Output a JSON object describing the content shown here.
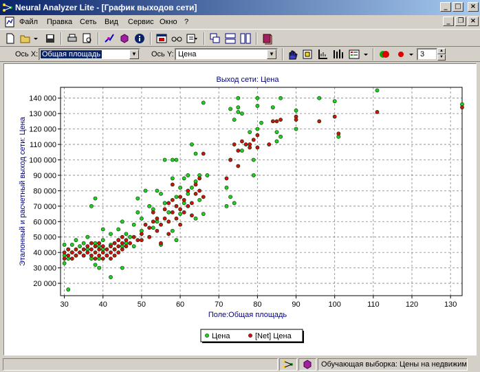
{
  "window": {
    "title": "Neural Analyzer Lite - [График выходов сети]",
    "minimize": "_",
    "maximize": "□",
    "close": "×",
    "restore": "❐"
  },
  "menu": {
    "items": [
      "Файл",
      "Правка",
      "Сеть",
      "Вид",
      "Сервис",
      "Окно",
      "?"
    ]
  },
  "toolbar": {
    "icons": [
      "new-file-icon",
      "open-folder-icon",
      "dropdown-arrow-icon",
      "save-icon",
      "print-icon",
      "print-preview-icon",
      "network-connect-icon",
      "cube-icon",
      "info-icon",
      "table-window-icon",
      "glasses-icon",
      "edit-dropdown-icon",
      "cascade-icon",
      "tile-horizontal-icon",
      "tile-vertical-icon",
      "book-icon"
    ]
  },
  "axis_bar": {
    "x_label": "Ось X:",
    "x_value": "Общая площадь",
    "y_label": "Ось Y:",
    "y_value": "Цена",
    "points_count": "3"
  },
  "colors": {
    "green": "#22cc22",
    "red": "#cc1111",
    "title_text": "#000080",
    "grid": "#808080"
  },
  "chart_data": {
    "type": "scatter",
    "title": "Выход сети: Цена",
    "xlabel": "Поле:Общая площадь",
    "ylabel": "Эталонный и расчетный выход сети: Цена",
    "xlim": [
      29,
      133
    ],
    "ylim": [
      12000,
      147000
    ],
    "x_ticks": [
      30,
      40,
      50,
      60,
      70,
      80,
      90,
      100,
      110,
      120,
      130
    ],
    "y_ticks": [
      20000,
      30000,
      40000,
      50000,
      60000,
      70000,
      80000,
      90000,
      100000,
      110000,
      120000,
      130000,
      140000
    ],
    "x_tick_labels": [
      "30",
      "40",
      "50",
      "60",
      "70",
      "80",
      "90",
      "100",
      "110",
      "120",
      "130"
    ],
    "y_tick_labels": [
      "20 000",
      "30 000",
      "40 000",
      "50 000",
      "60 000",
      "70 000",
      "80 000",
      "90 000",
      "100 000",
      "110 000",
      "120 000",
      "130 000",
      "140 000"
    ],
    "grid": true,
    "legend_position": "bottom",
    "series": [
      {
        "name": "Цена",
        "color": "#22cc22",
        "points": [
          [
            30,
            45
          ],
          [
            30,
            38
          ],
          [
            30,
            33
          ],
          [
            31,
            42
          ],
          [
            31,
            36
          ],
          [
            31,
            16
          ],
          [
            32,
            45
          ],
          [
            32,
            40
          ],
          [
            33,
            38
          ],
          [
            33,
            48
          ],
          [
            34,
            44
          ],
          [
            34,
            40
          ],
          [
            35,
            46
          ],
          [
            35,
            38
          ],
          [
            36,
            42
          ],
          [
            36,
            50
          ],
          [
            37,
            36
          ],
          [
            37,
            70
          ],
          [
            38,
            75
          ],
          [
            38,
            46
          ],
          [
            38,
            32
          ],
          [
            39,
            44
          ],
          [
            39,
            36
          ],
          [
            39,
            30
          ],
          [
            40,
            48
          ],
          [
            40,
            42
          ],
          [
            40,
            55
          ],
          [
            41,
            38
          ],
          [
            42,
            52
          ],
          [
            42,
            45
          ],
          [
            42,
            24
          ],
          [
            43,
            46
          ],
          [
            43,
            42
          ],
          [
            44,
            55
          ],
          [
            44,
            48
          ],
          [
            45,
            60
          ],
          [
            45,
            44
          ],
          [
            45,
            30
          ],
          [
            46,
            52
          ],
          [
            46,
            46
          ],
          [
            47,
            50
          ],
          [
            48,
            58
          ],
          [
            48,
            44
          ],
          [
            49,
            66
          ],
          [
            49,
            75
          ],
          [
            50,
            54
          ],
          [
            50,
            62
          ],
          [
            51,
            80
          ],
          [
            52,
            70
          ],
          [
            53,
            68
          ],
          [
            53,
            56
          ],
          [
            54,
            80
          ],
          [
            54,
            60
          ],
          [
            55,
            45
          ],
          [
            55,
            78
          ],
          [
            56,
            100
          ],
          [
            56,
            72
          ],
          [
            57,
            66
          ],
          [
            58,
            100
          ],
          [
            58,
            88
          ],
          [
            58,
            54
          ],
          [
            59,
            100
          ],
          [
            59,
            76
          ],
          [
            59,
            48
          ],
          [
            60,
            82
          ],
          [
            60,
            65
          ],
          [
            61,
            88
          ],
          [
            61,
            72
          ],
          [
            62,
            90
          ],
          [
            62,
            78
          ],
          [
            63,
            110
          ],
          [
            63,
            82
          ],
          [
            64,
            104
          ],
          [
            64,
            86
          ],
          [
            64,
            62
          ],
          [
            65,
            90
          ],
          [
            65,
            74
          ],
          [
            66,
            137
          ],
          [
            66,
            65
          ],
          [
            67,
            90
          ],
          [
            72,
            70
          ],
          [
            72,
            82
          ],
          [
            73,
            133
          ],
          [
            73,
            100
          ],
          [
            73,
            76
          ],
          [
            74,
            126
          ],
          [
            74,
            72
          ],
          [
            75,
            140
          ],
          [
            75,
            131
          ],
          [
            75,
            134
          ],
          [
            76,
            130
          ],
          [
            76,
            106
          ],
          [
            78,
            118
          ],
          [
            79,
            90
          ],
          [
            79,
            100
          ],
          [
            80,
            140
          ],
          [
            80,
            135
          ],
          [
            80,
            120
          ],
          [
            81,
            124
          ],
          [
            84,
            134
          ],
          [
            85,
            112
          ],
          [
            85,
            118
          ],
          [
            86,
            115
          ],
          [
            86,
            140
          ],
          [
            90,
            132
          ],
          [
            90,
            120
          ],
          [
            96,
            140
          ],
          [
            100,
            138
          ],
          [
            101,
            115
          ],
          [
            111,
            145
          ],
          [
            133,
            136
          ]
        ]
      },
      {
        "name": "[Net] Цена",
        "color": "#cc1111",
        "points": [
          [
            30,
            40
          ],
          [
            30,
            36
          ],
          [
            31,
            42
          ],
          [
            31,
            38
          ],
          [
            32,
            40
          ],
          [
            32,
            36
          ],
          [
            33,
            42
          ],
          [
            33,
            38
          ],
          [
            34,
            40
          ],
          [
            35,
            42
          ],
          [
            35,
            38
          ],
          [
            36,
            44
          ],
          [
            36,
            40
          ],
          [
            37,
            46
          ],
          [
            37,
            42
          ],
          [
            37,
            38
          ],
          [
            38,
            44
          ],
          [
            38,
            40
          ],
          [
            38,
            36
          ],
          [
            39,
            46
          ],
          [
            39,
            42
          ],
          [
            39,
            38
          ],
          [
            40,
            44
          ],
          [
            40,
            40
          ],
          [
            40,
            36
          ],
          [
            41,
            42
          ],
          [
            41,
            38
          ],
          [
            42,
            44
          ],
          [
            42,
            40
          ],
          [
            42,
            36
          ],
          [
            43,
            46
          ],
          [
            43,
            42
          ],
          [
            43,
            38
          ],
          [
            44,
            48
          ],
          [
            44,
            44
          ],
          [
            44,
            40
          ],
          [
            45,
            46
          ],
          [
            45,
            42
          ],
          [
            45,
            50
          ],
          [
            46,
            44
          ],
          [
            46,
            48
          ],
          [
            47,
            46
          ],
          [
            48,
            50
          ],
          [
            49,
            48
          ],
          [
            50,
            52
          ],
          [
            50,
            48
          ],
          [
            51,
            58
          ],
          [
            52,
            56
          ],
          [
            52,
            50
          ],
          [
            53,
            60
          ],
          [
            53,
            66
          ],
          [
            54,
            62
          ],
          [
            54,
            54
          ],
          [
            55,
            58
          ],
          [
            55,
            46
          ],
          [
            56,
            68
          ],
          [
            56,
            62
          ],
          [
            57,
            72
          ],
          [
            57,
            60
          ],
          [
            57,
            52
          ],
          [
            58,
            84
          ],
          [
            58,
            74
          ],
          [
            58,
            66
          ],
          [
            59,
            70
          ],
          [
            59,
            62
          ],
          [
            60,
            76
          ],
          [
            60,
            68
          ],
          [
            60,
            58
          ],
          [
            61,
            74
          ],
          [
            61,
            66
          ],
          [
            62,
            80
          ],
          [
            62,
            70
          ],
          [
            63,
            72
          ],
          [
            63,
            64
          ],
          [
            64,
            84
          ],
          [
            64,
            78
          ],
          [
            65,
            88
          ],
          [
            65,
            80
          ],
          [
            66,
            104
          ],
          [
            66,
            76
          ],
          [
            72,
            88
          ],
          [
            73,
            100
          ],
          [
            74,
            110
          ],
          [
            75,
            106
          ],
          [
            75,
            96
          ],
          [
            76,
            112
          ],
          [
            77,
            110
          ],
          [
            78,
            110
          ],
          [
            78,
            108
          ],
          [
            79,
            113
          ],
          [
            80,
            108
          ],
          [
            80,
            116
          ],
          [
            83,
            110
          ],
          [
            84,
            125
          ],
          [
            85,
            125
          ],
          [
            86,
            126
          ],
          [
            90,
            128
          ],
          [
            90,
            126
          ],
          [
            96,
            125
          ],
          [
            100,
            128
          ],
          [
            101,
            117
          ],
          [
            111,
            131
          ],
          [
            133,
            134
          ]
        ]
      }
    ]
  },
  "legend": {
    "labels": [
      "Цена",
      "[Net] Цена"
    ]
  },
  "status": {
    "text": "Обучающая выборка: Цены на недвижим"
  }
}
